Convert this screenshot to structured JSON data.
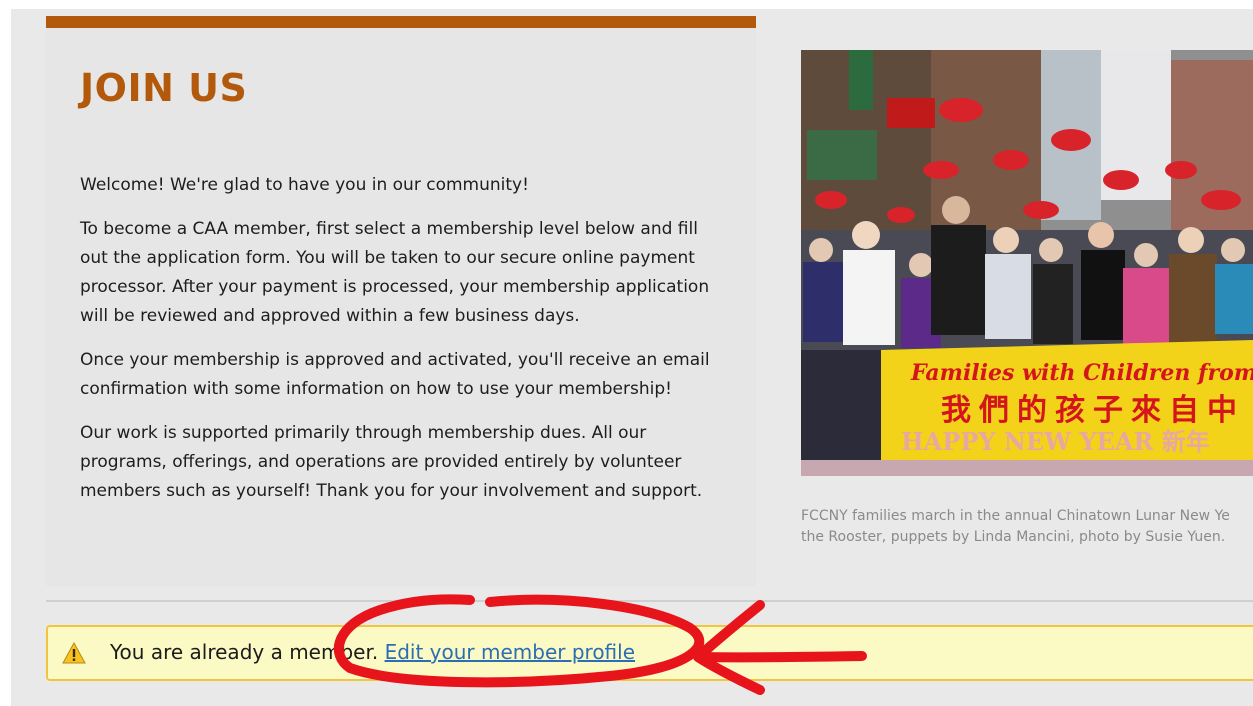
{
  "join": {
    "title": "JOIN US",
    "paragraphs": [
      "Welcome! We're glad to have you in our community!",
      "To become a CAA member, first select a membership level below and fill out the application form. You will be taken to our secure online payment processor. After your payment is processed, your membership application will be reviewed and approved within a few business days.",
      "Once your membership is approved and activated, you'll receive an email confirmation with some information on how to use your membership!",
      "Our work is supported primarily through membership dues. All our programs, offerings, and operations are provided entirely by volunteer members such as yourself! Thank you for your involvement and support."
    ]
  },
  "photo": {
    "banner_line1": "Families with Children from",
    "banner_line2": "我們的孩子來自中",
    "banner_line3": "HAPPY NEW YEAR 新年"
  },
  "caption": {
    "line1": "FCCNY families march in the annual Chinatown Lunar New Ye",
    "line2": "the Rooster, puppets by Linda Mancini, photo by Susie Yuen."
  },
  "alert": {
    "icon": "warning-icon",
    "text": "You are already a memb",
    "text_obscured": "er.",
    "link": "Edit your member profile"
  },
  "colors": {
    "accent": "#b3590b",
    "alert_bg": "#fbf9c4",
    "alert_border": "#f1c540",
    "link": "#2a6fb3",
    "annotation": "#e8141b"
  }
}
